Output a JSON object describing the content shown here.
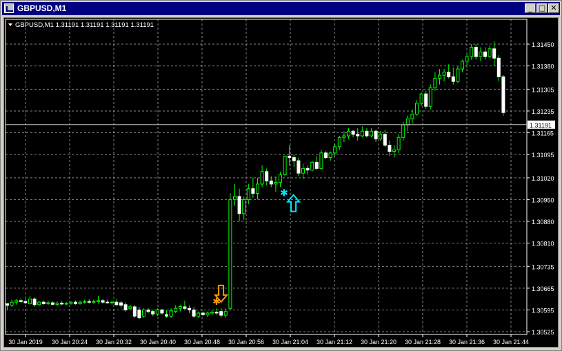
{
  "window": {
    "title": "GBPUSD,M1"
  },
  "title_buttons": {
    "minimize": "_",
    "maximize": "□",
    "close": "✕"
  },
  "colors": {
    "background": "#000000",
    "grid": "#c0c0c0",
    "bull": "#00ff00",
    "bear": "#ffffff",
    "buy_signal": "#00e5ff",
    "sell_signal": "#ff9900"
  },
  "chart_data": {
    "type": "candlestick",
    "title": "GBPUSD,M1  1.31191 1.31191 1.31191 1.31191",
    "symbol": "GBPUSD,M1",
    "ohlc_header": "1.31191 1.31191 1.31191 1.31191",
    "current_price": "1.31191",
    "ylim": [
      1.30525,
      1.3149
    ],
    "y_ticks": [
      "1.31450",
      "1.31380",
      "1.31305",
      "1.31235",
      "1.31165",
      "1.31095",
      "1.31020",
      "1.30950",
      "1.30880",
      "1.30810",
      "1.30735",
      "1.30665",
      "1.30595",
      "1.30525"
    ],
    "x_ticks": [
      "30 Jan 2019",
      "30 Jan 20:24",
      "30 Jan 20:32",
      "30 Jan 20:40",
      "30 Jan 20:48",
      "30 Jan 20:56",
      "30 Jan 21:04",
      "30 Jan 21:12",
      "30 Jan 21:20",
      "30 Jan 21:28",
      "30 Jan 21:36",
      "30 Jan 21:44"
    ],
    "grid": true,
    "candles": [
      [
        1.30615,
        1.30615,
        1.30595,
        1.3061
      ],
      [
        1.3061,
        1.30628,
        1.30605,
        1.3062
      ],
      [
        1.3062,
        1.3063,
        1.30612,
        1.30625
      ],
      [
        1.30625,
        1.30632,
        1.30618,
        1.30622
      ],
      [
        1.30622,
        1.3063,
        1.30615,
        1.30618
      ],
      [
        1.30615,
        1.3064,
        1.30612,
        1.3063
      ],
      [
        1.3063,
        1.30635,
        1.30605,
        1.30612
      ],
      [
        1.30612,
        1.30625,
        1.30608,
        1.3062
      ],
      [
        1.3062,
        1.30625,
        1.30612,
        1.30615
      ],
      [
        1.30615,
        1.30625,
        1.3061,
        1.30618
      ],
      [
        1.30618,
        1.30622,
        1.3061,
        1.30613
      ],
      [
        1.30613,
        1.30622,
        1.30608,
        1.30617
      ],
      [
        1.30617,
        1.30625,
        1.3061,
        1.30614
      ],
      [
        1.30614,
        1.3062,
        1.3061,
        1.30616
      ],
      [
        1.30616,
        1.30622,
        1.30612,
        1.3062
      ],
      [
        1.3062,
        1.30625,
        1.30612,
        1.30615
      ],
      [
        1.30615,
        1.30625,
        1.30612,
        1.3062
      ],
      [
        1.3062,
        1.30628,
        1.30615,
        1.30622
      ],
      [
        1.30622,
        1.3063,
        1.30615,
        1.3062
      ],
      [
        1.3062,
        1.30628,
        1.30615,
        1.30622
      ],
      [
        1.30622,
        1.3064,
        1.30615,
        1.30625
      ],
      [
        1.30625,
        1.3063,
        1.30615,
        1.3062
      ],
      [
        1.3062,
        1.30628,
        1.30615,
        1.30618
      ],
      [
        1.30618,
        1.30625,
        1.30612,
        1.3062
      ],
      [
        1.3062,
        1.3063,
        1.30608,
        1.30612
      ],
      [
        1.30618,
        1.30625,
        1.306,
        1.3061
      ],
      [
        1.30612,
        1.3062,
        1.3059,
        1.30595
      ],
      [
        1.306,
        1.30612,
        1.30595,
        1.30605
      ],
      [
        1.30605,
        1.3061,
        1.3057,
        1.30575
      ],
      [
        1.30595,
        1.30605,
        1.30565,
        1.3057
      ],
      [
        1.30575,
        1.306,
        1.3057,
        1.30595
      ],
      [
        1.30595,
        1.306,
        1.30585,
        1.3059
      ],
      [
        1.3059,
        1.30595,
        1.30575,
        1.30582
      ],
      [
        1.30582,
        1.306,
        1.30575,
        1.30595
      ],
      [
        1.30595,
        1.30598,
        1.3058,
        1.30585
      ],
      [
        1.3058,
        1.30595,
        1.3057,
        1.30575
      ],
      [
        1.30575,
        1.306,
        1.3057,
        1.30592
      ],
      [
        1.3059,
        1.3061,
        1.30585,
        1.306
      ],
      [
        1.306,
        1.30612,
        1.3059,
        1.30606
      ],
      [
        1.30605,
        1.30625,
        1.30595,
        1.306
      ],
      [
        1.306,
        1.3061,
        1.30585,
        1.30595
      ],
      [
        1.30595,
        1.30605,
        1.3057,
        1.30575
      ],
      [
        1.30575,
        1.3059,
        1.3057,
        1.30585
      ],
      [
        1.30585,
        1.3059,
        1.30575,
        1.3058
      ],
      [
        1.3058,
        1.3059,
        1.30572,
        1.30585
      ],
      [
        1.30585,
        1.30595,
        1.30578,
        1.30588
      ],
      [
        1.30588,
        1.306,
        1.3058,
        1.30585
      ],
      [
        1.3059,
        1.306,
        1.3057,
        1.30578
      ],
      [
        1.30578,
        1.306,
        1.3057,
        1.3059
      ],
      [
        1.306,
        1.3097,
        1.30595,
        1.3095
      ],
      [
        1.3095,
        1.31,
        1.3093,
        1.3096
      ],
      [
        1.3096,
        1.30985,
        1.3088,
        1.30905
      ],
      [
        1.30905,
        1.3096,
        1.30885,
        1.3095
      ],
      [
        1.3095,
        1.31,
        1.30935,
        1.30985
      ],
      [
        1.30985,
        1.3102,
        1.30955,
        1.3097
      ],
      [
        1.3097,
        1.3102,
        1.3095,
        1.31
      ],
      [
        1.31,
        1.3106,
        1.3099,
        1.3104
      ],
      [
        1.3104,
        1.3105,
        1.30995,
        1.3101
      ],
      [
        1.3101,
        1.31025,
        1.3099,
        1.31
      ],
      [
        1.31,
        1.31025,
        1.30975,
        1.31005
      ],
      [
        1.31005,
        1.3104,
        1.3099,
        1.3103
      ],
      [
        1.3103,
        1.3109,
        1.31025,
        1.3109
      ],
      [
        1.3109,
        1.31125,
        1.3106,
        1.31085
      ],
      [
        1.31085,
        1.31095,
        1.31055,
        1.31075
      ],
      [
        1.31075,
        1.31085,
        1.31025,
        1.31035
      ],
      [
        1.31035,
        1.31065,
        1.31015,
        1.3105
      ],
      [
        1.3105,
        1.3106,
        1.3103,
        1.31045
      ],
      [
        1.31045,
        1.31075,
        1.3104,
        1.3107
      ],
      [
        1.3107,
        1.3109,
        1.31045,
        1.3105
      ],
      [
        1.3105,
        1.3111,
        1.31045,
        1.311
      ],
      [
        1.311,
        1.31105,
        1.3108,
        1.31085
      ],
      [
        1.31085,
        1.31105,
        1.31075,
        1.311
      ],
      [
        1.311,
        1.3113,
        1.3109,
        1.3112
      ],
      [
        1.3112,
        1.31155,
        1.3111,
        1.3115
      ],
      [
        1.3115,
        1.3117,
        1.31135,
        1.31155
      ],
      [
        1.31155,
        1.3118,
        1.31145,
        1.3117
      ],
      [
        1.3117,
        1.31175,
        1.3115,
        1.3116
      ],
      [
        1.3116,
        1.3118,
        1.3114,
        1.31155
      ],
      [
        1.31155,
        1.31185,
        1.3115,
        1.3117
      ],
      [
        1.3117,
        1.3118,
        1.3115,
        1.31155
      ],
      [
        1.31155,
        1.3118,
        1.3115,
        1.3117
      ],
      [
        1.3117,
        1.31175,
        1.31135,
        1.31145
      ],
      [
        1.31145,
        1.3117,
        1.3114,
        1.3116
      ],
      [
        1.3116,
        1.31175,
        1.3112,
        1.31125
      ],
      [
        1.31125,
        1.3114,
        1.3109,
        1.31105
      ],
      [
        1.31105,
        1.31125,
        1.31085,
        1.3111
      ],
      [
        1.3111,
        1.3116,
        1.311,
        1.3115
      ],
      [
        1.3115,
        1.312,
        1.3114,
        1.3119
      ],
      [
        1.3119,
        1.3122,
        1.3117,
        1.3121
      ],
      [
        1.3121,
        1.3124,
        1.31195,
        1.31225
      ],
      [
        1.31225,
        1.3127,
        1.3122,
        1.3126
      ],
      [
        1.3126,
        1.31295,
        1.3125,
        1.3129
      ],
      [
        1.3129,
        1.313,
        1.3124,
        1.3125
      ],
      [
        1.3125,
        1.3132,
        1.3124,
        1.3131
      ],
      [
        1.3131,
        1.3136,
        1.313,
        1.3134
      ],
      [
        1.3134,
        1.3137,
        1.3132,
        1.3135
      ],
      [
        1.3135,
        1.3137,
        1.3133,
        1.3136
      ],
      [
        1.3136,
        1.31385,
        1.3134,
        1.31345
      ],
      [
        1.31345,
        1.31375,
        1.3132,
        1.3133
      ],
      [
        1.3133,
        1.3138,
        1.31325,
        1.3137
      ],
      [
        1.3137,
        1.314,
        1.3136,
        1.31395
      ],
      [
        1.31395,
        1.3142,
        1.31375,
        1.3141
      ],
      [
        1.3141,
        1.3145,
        1.314,
        1.3144
      ],
      [
        1.3144,
        1.3145,
        1.314,
        1.3141
      ],
      [
        1.3141,
        1.3144,
        1.31395,
        1.31425
      ],
      [
        1.31425,
        1.3144,
        1.314,
        1.3141
      ],
      [
        1.3141,
        1.31445,
        1.31405,
        1.31435
      ],
      [
        1.31435,
        1.3146,
        1.3138,
        1.31405
      ],
      [
        1.31405,
        1.31415,
        1.3133,
        1.31345
      ],
      [
        1.31345,
        1.3135,
        1.3122,
        1.3123
      ]
    ],
    "signals": [
      {
        "type": "sell",
        "candle_index": 46,
        "price": 1.30625
      },
      {
        "type": "buy",
        "candle_index": 61,
        "price": 1.30965
      }
    ]
  }
}
